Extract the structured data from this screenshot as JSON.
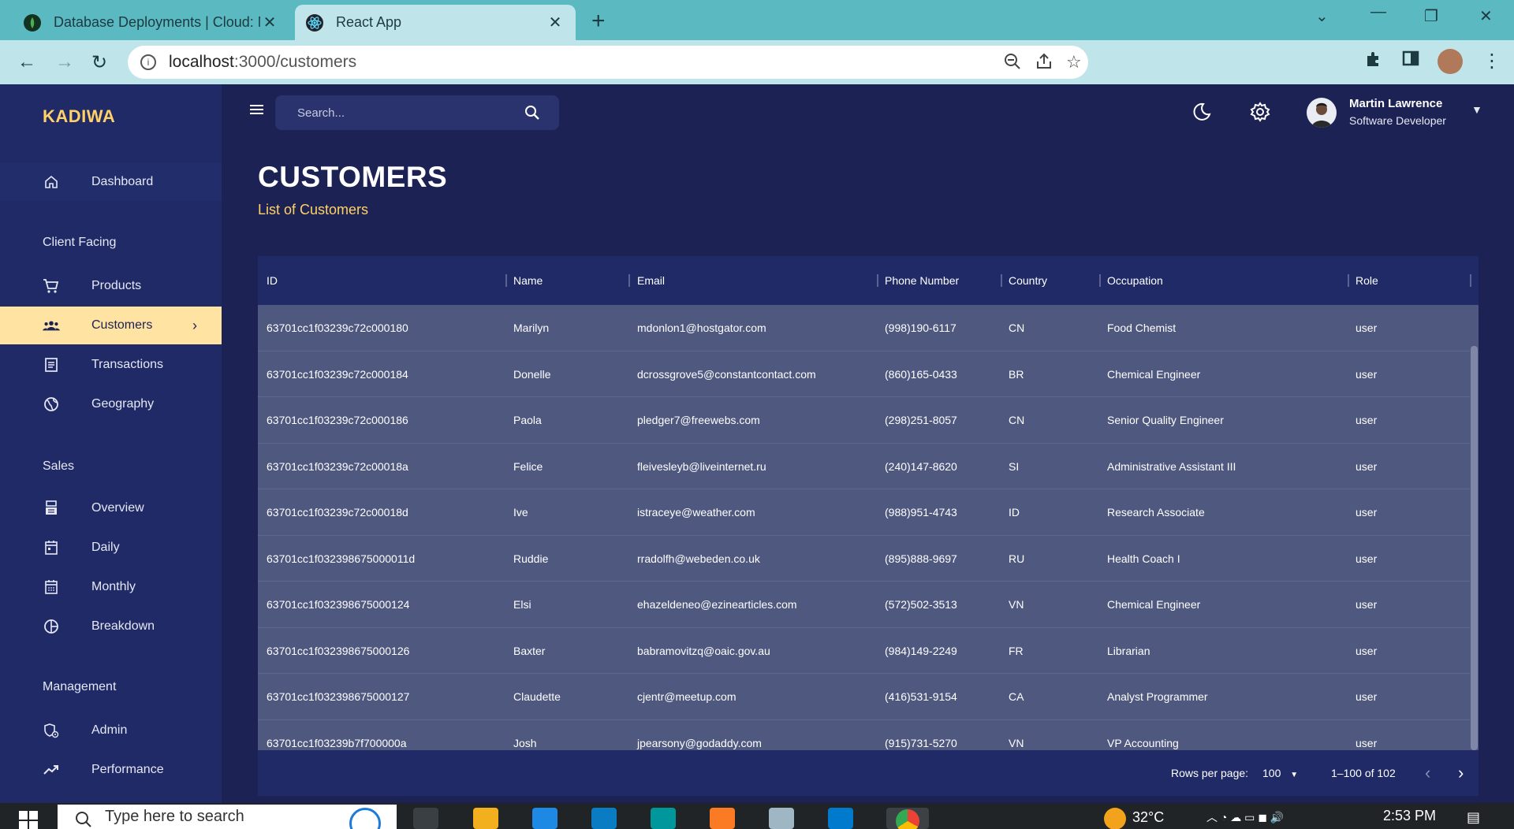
{
  "browser": {
    "tabs": [
      {
        "title": "Database Deployments | Cloud: M",
        "active": false,
        "icon": "mongodb-leaf-icon"
      },
      {
        "title": "React App",
        "active": true,
        "icon": "react-icon"
      }
    ],
    "url_host": "localhost",
    "url_path": ":3000/customers"
  },
  "app": {
    "brand": "KADIWA",
    "search_placeholder": "Search...",
    "user": {
      "name": "Martin Lawrence",
      "role": "Software Developer"
    }
  },
  "sidebar": {
    "dashboard": "Dashboard",
    "sections": {
      "client": "Client Facing",
      "sales": "Sales",
      "management": "Management"
    },
    "items": {
      "products": "Products",
      "customers": "Customers",
      "transactions": "Transactions",
      "geography": "Geography",
      "overview": "Overview",
      "daily": "Daily",
      "monthly": "Monthly",
      "breakdown": "Breakdown",
      "admin": "Admin",
      "performance": "Performance"
    },
    "active": "customers"
  },
  "page": {
    "title": "CUSTOMERS",
    "subtitle": "List of Customers"
  },
  "table": {
    "headers": [
      "ID",
      "Name",
      "Email",
      "Phone Number",
      "Country",
      "Occupation",
      "Role"
    ],
    "rows": [
      [
        "63701cc1f03239c72c000180",
        "Marilyn",
        "mdonlon1@hostgator.com",
        "(998)190-6117",
        "CN",
        "Food Chemist",
        "user"
      ],
      [
        "63701cc1f03239c72c000184",
        "Donelle",
        "dcrossgrove5@constantcontact.com",
        "(860)165-0433",
        "BR",
        "Chemical Engineer",
        "user"
      ],
      [
        "63701cc1f03239c72c000186",
        "Paola",
        "pledger7@freewebs.com",
        "(298)251-8057",
        "CN",
        "Senior Quality Engineer",
        "user"
      ],
      [
        "63701cc1f03239c72c00018a",
        "Felice",
        "fleivesleyb@liveinternet.ru",
        "(240)147-8620",
        "SI",
        "Administrative Assistant III",
        "user"
      ],
      [
        "63701cc1f03239c72c00018d",
        "Ive",
        "istraceye@weather.com",
        "(988)951-4743",
        "ID",
        "Research Associate",
        "user"
      ],
      [
        "63701cc1f032398675000011d",
        "Ruddie",
        "rradolfh@webeden.co.uk",
        "(895)888-9697",
        "RU",
        "Health Coach I",
        "user"
      ],
      [
        "63701cc1f032398675000124",
        "Elsi",
        "ehazeldeneo@ezinearticles.com",
        "(572)502-3513",
        "VN",
        "Chemical Engineer",
        "user"
      ],
      [
        "63701cc1f032398675000126",
        "Baxter",
        "babramovitzq@oaic.gov.au",
        "(984)149-2249",
        "FR",
        "Librarian",
        "user"
      ],
      [
        "63701cc1f032398675000127",
        "Claudette",
        "cjentr@meetup.com",
        "(416)531-9154",
        "CA",
        "Analyst Programmer",
        "user"
      ],
      [
        "63701cc1f03239b7f700000a",
        "Josh",
        "jpearsony@godaddy.com",
        "(915)731-5270",
        "VN",
        "VP Accounting",
        "user"
      ]
    ],
    "footer": {
      "rows_per_page_label": "Rows per page:",
      "rows_per_page_value": "100",
      "range": "1–100 of 102"
    }
  },
  "taskbar": {
    "search_placeholder": "Type here to search",
    "temperature": "32°C",
    "time": "2:53 PM"
  },
  "colors": {
    "accent": "#ffd166",
    "active_nav": "#ffe3a3",
    "background": "#1c2254",
    "sidebar": "#1f2a66",
    "table_body": "#4f587f"
  }
}
